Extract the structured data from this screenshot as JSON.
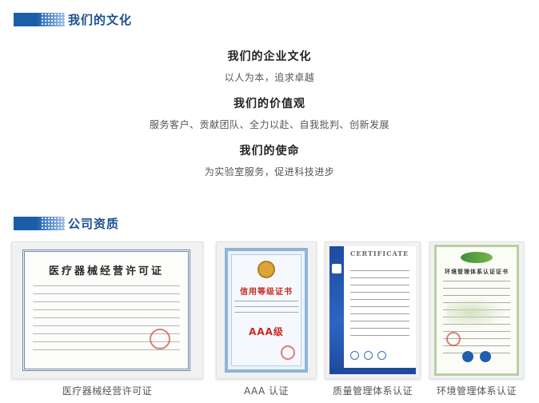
{
  "culture_section": {
    "title": "我们的文化",
    "items": [
      {
        "heading": "我们的企业文化",
        "text": "以人为本，追求卓越"
      },
      {
        "heading": "我们的价值观",
        "text": "服务客户、贡献团队、全力以赴、自我批判、创新发展"
      },
      {
        "heading": "我们的使命",
        "text": "为实验室服务，促进科技进步"
      }
    ]
  },
  "qualification_section": {
    "title": "公司资质",
    "certificates": [
      {
        "caption": "医疗器械经营许可证",
        "doc_title": "医疗器械经营许可证"
      },
      {
        "caption": "AAA 认证",
        "doc_title": "信用等级证书",
        "grade": "AAA级"
      },
      {
        "caption": "质量管理体系认证",
        "doc_title": "CERTIFICATE"
      },
      {
        "caption": "环境管理体系认证",
        "doc_title": "环境管理体系认证证书"
      }
    ]
  },
  "colors": {
    "accent": "#1a5ea8",
    "highlight": "#a9d3f2"
  }
}
